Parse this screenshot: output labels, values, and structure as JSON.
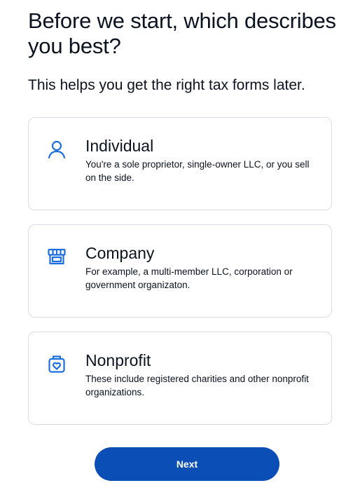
{
  "header": {
    "title": "Before we start, which describes you best?",
    "subtitle": "This helps you get the right tax forms later."
  },
  "options": [
    {
      "icon": "person-icon",
      "title": "Individual",
      "description": "You're a sole proprietor, single-owner LLC, or you sell on the side."
    },
    {
      "icon": "storefront-icon",
      "title": "Company",
      "description": "For example, a multi-member LLC, corporation or government organizaton."
    },
    {
      "icon": "charity-heart-icon",
      "title": "Nonprofit",
      "description": "These include registered charities and other nonprofit organizations."
    }
  ],
  "footer": {
    "next_label": "Next"
  },
  "colors": {
    "accent": "#0b4eb5",
    "icon": "#1d6fe0",
    "border": "#d9dde3",
    "text": "#0b1220"
  }
}
